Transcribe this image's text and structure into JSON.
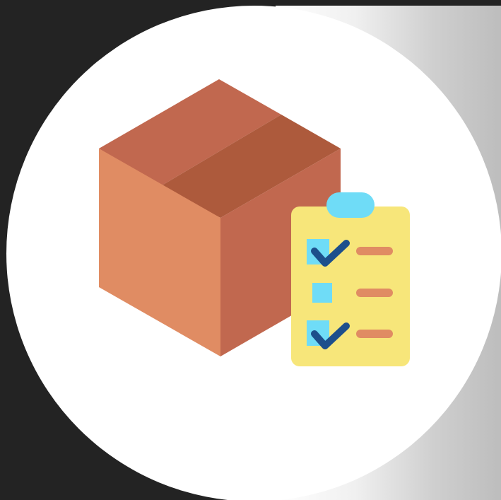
{
  "image": {
    "subject": "package-checklist-icon",
    "colors": {
      "background": "#232323",
      "circle": "#ffffff",
      "box_top_left": "#c1684f",
      "box_top_right": "#ad5a3c",
      "box_front_left": "#e08c63",
      "box_front_right": "#c1684f",
      "clipboard": "#f7e67a",
      "clipboard_clip": "#6fdcf7",
      "checkbox": "#6fdcf7",
      "checkmark": "#1d4f8c",
      "line_item": "#e08c63"
    }
  }
}
